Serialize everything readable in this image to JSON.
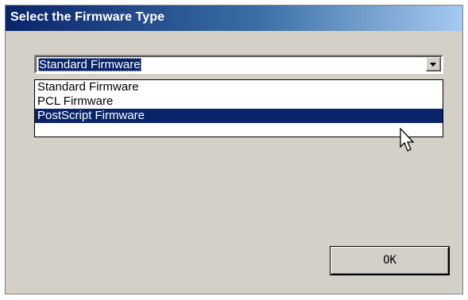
{
  "dialog": {
    "title": "Select the Firmware Type"
  },
  "combo": {
    "selected_value": "Standard Firmware"
  },
  "dropdown": {
    "options": [
      {
        "label": "Standard Firmware",
        "highlighted": false
      },
      {
        "label": "PCL Firmware",
        "highlighted": false
      },
      {
        "label": "PostScript Firmware",
        "highlighted": true
      }
    ]
  },
  "buttons": {
    "ok_label": "OK"
  },
  "icons": {
    "dropdown_arrow": "chevron-down-icon",
    "cursor": "mouse-pointer-icon"
  },
  "colors": {
    "selection": "#0a246a",
    "dialog_bg": "#d4d0c8",
    "title_gradient_start": "#0a246a",
    "title_gradient_end": "#a6caf0"
  }
}
